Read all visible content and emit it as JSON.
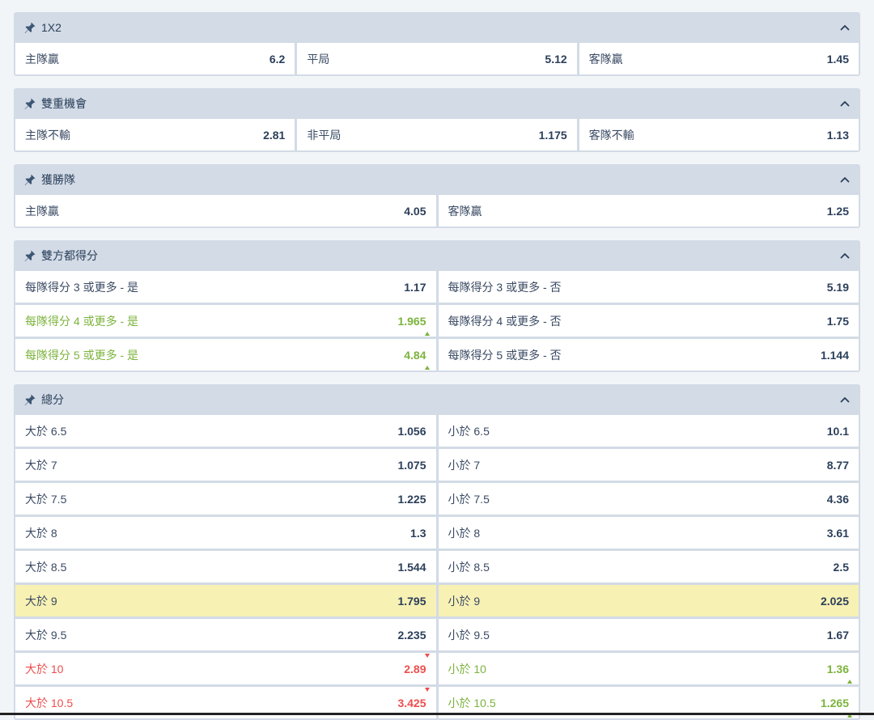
{
  "colors": {
    "header_bg": "#d2dbe6",
    "cell_bg": "#ffffff",
    "highlight": "#f8f1b4",
    "up": "#7cb33c",
    "down": "#ee4d4d",
    "text": "#2b3f5a"
  },
  "icons": {
    "pin": "pin-icon",
    "collapse": "chevron-up-icon",
    "up": "arrow-up-icon",
    "down": "arrow-down-icon"
  },
  "markets": [
    {
      "title": "1X2",
      "rows": [
        [
          {
            "label": "主隊贏",
            "odds": "6.2"
          },
          {
            "label": "平局",
            "odds": "5.12"
          },
          {
            "label": "客隊贏",
            "odds": "1.45"
          }
        ]
      ]
    },
    {
      "title": "雙重機會",
      "rows": [
        [
          {
            "label": "主隊不輸",
            "odds": "2.81"
          },
          {
            "label": "非平局",
            "odds": "1.175"
          },
          {
            "label": "客隊不輸",
            "odds": "1.13"
          }
        ]
      ]
    },
    {
      "title": "獲勝隊",
      "rows": [
        [
          {
            "label": "主隊贏",
            "odds": "4.05"
          },
          {
            "label": "客隊贏",
            "odds": "1.25"
          }
        ]
      ]
    },
    {
      "title": "雙方都得分",
      "rows": [
        [
          {
            "label": "每隊得分 3 或更多 - 是",
            "odds": "1.17"
          },
          {
            "label": "每隊得分 3 或更多 - 否",
            "odds": "5.19"
          }
        ],
        [
          {
            "label": "每隊得分 4 或更多 - 是",
            "odds": "1.965",
            "trend": "up"
          },
          {
            "label": "每隊得分 4 或更多 - 否",
            "odds": "1.75"
          }
        ],
        [
          {
            "label": "每隊得分 5 或更多 - 是",
            "odds": "4.84",
            "trend": "up"
          },
          {
            "label": "每隊得分 5 或更多 - 否",
            "odds": "1.144"
          }
        ]
      ]
    },
    {
      "title": "總分",
      "rows": [
        [
          {
            "label": "大於 6.5",
            "odds": "1.056"
          },
          {
            "label": "小於 6.5",
            "odds": "10.1"
          }
        ],
        [
          {
            "label": "大於 7",
            "odds": "1.075"
          },
          {
            "label": "小於 7",
            "odds": "8.77"
          }
        ],
        [
          {
            "label": "大於 7.5",
            "odds": "1.225"
          },
          {
            "label": "小於 7.5",
            "odds": "4.36"
          }
        ],
        [
          {
            "label": "大於 8",
            "odds": "1.3"
          },
          {
            "label": "小於 8",
            "odds": "3.61"
          }
        ],
        [
          {
            "label": "大於 8.5",
            "odds": "1.544"
          },
          {
            "label": "小於 8.5",
            "odds": "2.5"
          }
        ],
        [
          {
            "label": "大於 9",
            "odds": "1.795",
            "highlight": true
          },
          {
            "label": "小於 9",
            "odds": "2.025",
            "highlight": true
          }
        ],
        [
          {
            "label": "大於 9.5",
            "odds": "2.235"
          },
          {
            "label": "小於 9.5",
            "odds": "1.67"
          }
        ],
        [
          {
            "label": "大於 10",
            "odds": "2.89",
            "trend": "down"
          },
          {
            "label": "小於 10",
            "odds": "1.36",
            "trend": "up"
          }
        ],
        [
          {
            "label": "大於 10.5",
            "odds": "3.425",
            "trend": "down"
          },
          {
            "label": "小於 10.5",
            "odds": "1.265",
            "trend": "up"
          }
        ]
      ]
    }
  ]
}
